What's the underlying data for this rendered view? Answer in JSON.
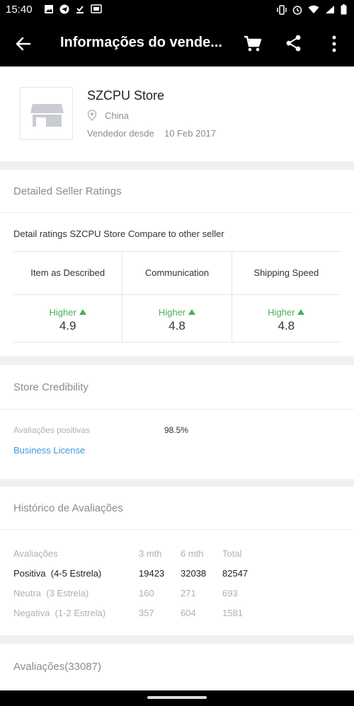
{
  "status_bar": {
    "time": "15:40",
    "left_icons": [
      "image-icon",
      "telegram-icon",
      "download-done-icon",
      "cast-icon"
    ],
    "right_icons": [
      "vibrate-icon",
      "alarm-icon",
      "wifi-icon",
      "signal-icon",
      "battery-icon"
    ]
  },
  "app_bar": {
    "title": "Informações do vende...",
    "back_icon": "arrow-left-icon",
    "cart_icon": "cart-icon",
    "share_icon": "share-icon",
    "more_icon": "more-vertical-icon"
  },
  "seller": {
    "name": "SZCPU Store",
    "country": "China",
    "since_label": "Vendedor desde",
    "since_date": "10 Feb 2017",
    "logo_icon": "store-icon"
  },
  "ratings": {
    "title": "Detailed Seller Ratings",
    "description": "Detail ratings SZCPU Store Compare to other seller",
    "columns": [
      {
        "label": "Item as Described",
        "comparison": "Higher",
        "value": "4.9"
      },
      {
        "label": "Communication",
        "comparison": "Higher",
        "value": "4.8"
      },
      {
        "label": "Shipping Speed",
        "comparison": "Higher",
        "value": "4.8"
      }
    ]
  },
  "credibility": {
    "title": "Store Credibility",
    "positive_label": "Avaliações positivas",
    "positive_value": "98.5%",
    "license_link": "Business License"
  },
  "history": {
    "title": "Histórico de Avaliações",
    "headers": [
      "Avaliações",
      "3 mth",
      "6 mth",
      "Total"
    ],
    "rows": [
      {
        "label": "Positiva  (4-5 Estrela)",
        "m3": "19423",
        "m6": "32038",
        "total": "82547"
      },
      {
        "label": "Neutra  (3 Estrela)",
        "m3": "160",
        "m6": "271",
        "total": "693"
      },
      {
        "label": "Negativa  (1-2 Estrela)",
        "m3": "357",
        "m6": "604",
        "total": "1581"
      }
    ]
  },
  "reviews": {
    "title": "Avaliações(33087)"
  },
  "colors": {
    "accent_green": "#4caf50",
    "link_blue": "#3a9bd9",
    "bar_black": "#000000"
  }
}
